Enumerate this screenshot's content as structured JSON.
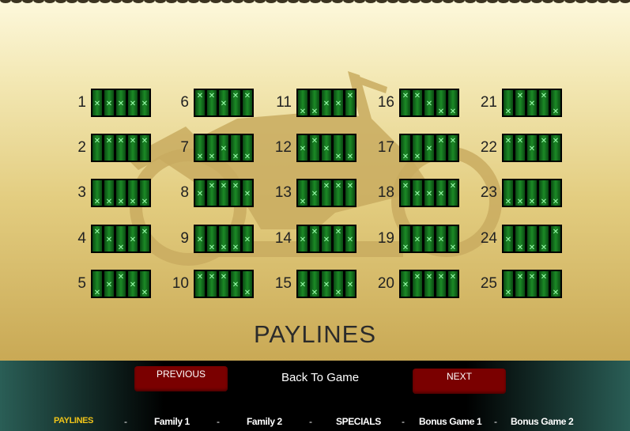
{
  "title": "PAYLINES",
  "buttons": {
    "previous": "PREVIOUS",
    "next": "NEXT",
    "back": "Back To Game"
  },
  "tabs": [
    "PAYLINES",
    "Family 1",
    "Family 2",
    "SPECIALS",
    "Bonus Game 1",
    "Bonus Game 2"
  ],
  "active_tab": "PAYLINES",
  "separator": "-",
  "colors": {
    "accent": "#f0c419",
    "button": "#7a0000",
    "symbol": "#1b8a26"
  },
  "paylines": [
    {
      "label": "1",
      "rows": [
        1,
        1,
        1,
        1,
        1
      ]
    },
    {
      "label": "2",
      "rows": [
        0,
        0,
        0,
        0,
        0
      ]
    },
    {
      "label": "3",
      "rows": [
        2,
        2,
        2,
        2,
        2
      ]
    },
    {
      "label": "4",
      "rows": [
        0,
        1,
        2,
        1,
        0
      ]
    },
    {
      "label": "5",
      "rows": [
        2,
        1,
        0,
        1,
        2
      ]
    },
    {
      "label": "6",
      "rows": [
        0,
        0,
        1,
        0,
        0
      ]
    },
    {
      "label": "7",
      "rows": [
        2,
        2,
        1,
        2,
        2
      ]
    },
    {
      "label": "8",
      "rows": [
        1,
        0,
        0,
        0,
        1
      ]
    },
    {
      "label": "9",
      "rows": [
        1,
        2,
        2,
        2,
        1
      ]
    },
    {
      "label": "10",
      "rows": [
        0,
        0,
        0,
        1,
        2
      ]
    },
    {
      "label": "11",
      "rows": [
        2,
        2,
        1,
        1,
        0
      ]
    },
    {
      "label": "12",
      "rows": [
        1,
        0,
        1,
        2,
        2
      ]
    },
    {
      "label": "13",
      "rows": [
        2,
        1,
        0,
        0,
        0
      ]
    },
    {
      "label": "14",
      "rows": [
        1,
        0,
        1,
        0,
        1
      ]
    },
    {
      "label": "15",
      "rows": [
        1,
        2,
        1,
        2,
        1
      ]
    },
    {
      "label": "16",
      "rows": [
        0,
        0,
        1,
        2,
        2
      ]
    },
    {
      "label": "17",
      "rows": [
        2,
        2,
        1,
        0,
        0
      ]
    },
    {
      "label": "18",
      "rows": [
        0,
        1,
        1,
        1,
        0
      ]
    },
    {
      "label": "19",
      "rows": [
        2,
        1,
        1,
        1,
        2
      ]
    },
    {
      "label": "20",
      "rows": [
        1,
        0,
        0,
        0,
        0
      ]
    },
    {
      "label": "21",
      "rows": [
        2,
        0,
        1,
        0,
        2
      ]
    },
    {
      "label": "22",
      "rows": [
        0,
        0,
        1,
        0,
        0
      ]
    },
    {
      "label": "23",
      "rows": [
        2,
        2,
        2,
        2,
        2
      ]
    },
    {
      "label": "24",
      "rows": [
        1,
        2,
        2,
        2,
        0
      ]
    },
    {
      "label": "25",
      "rows": [
        2,
        0,
        0,
        0,
        2
      ]
    }
  ]
}
